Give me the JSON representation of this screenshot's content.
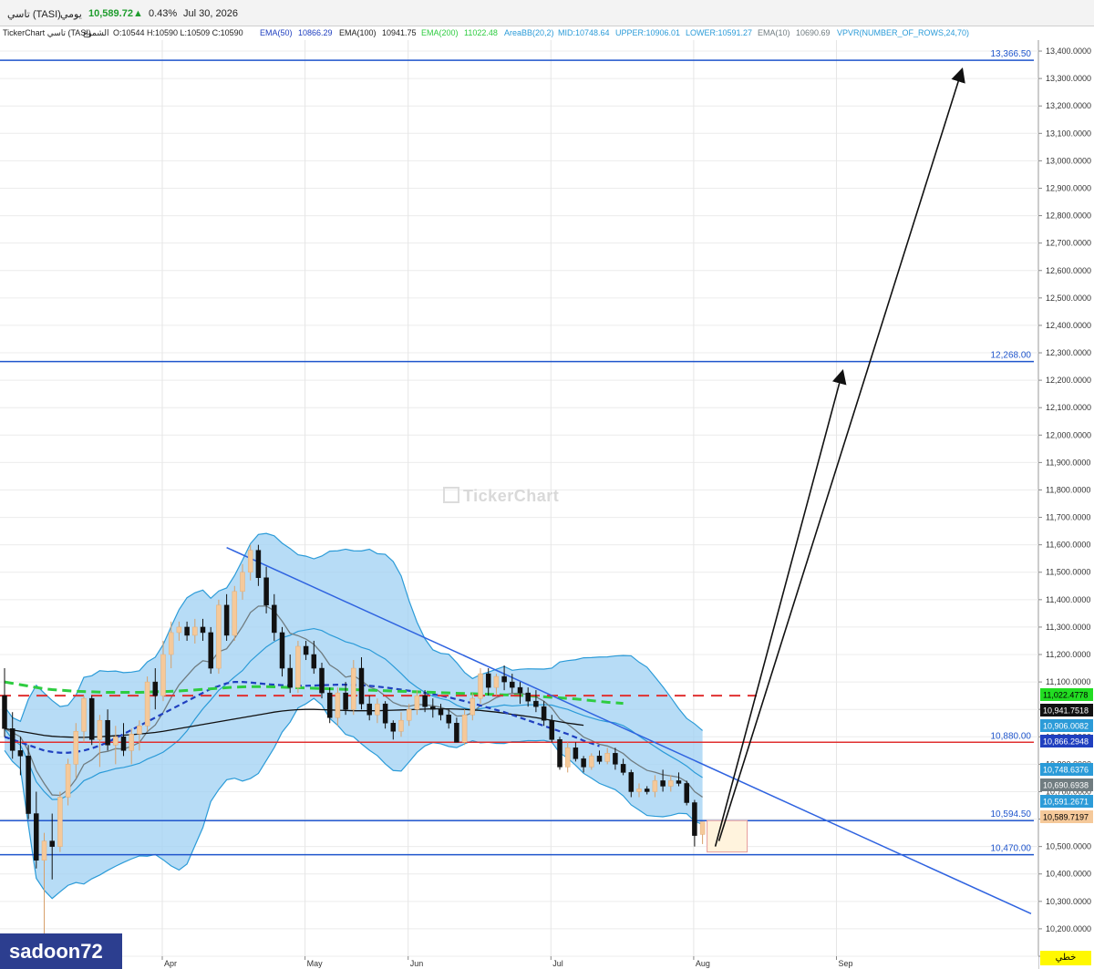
{
  "header": {
    "symbol": "تاسي (TASI)",
    "period": "يومي",
    "price": "10,589.72",
    "change_pct": "0.43%",
    "date": "Jul 30, 2026"
  },
  "legend": {
    "source": "TickerChart تاسي (TASI)",
    "candles_label": "الشموع",
    "ohlc": "O:10544  H:10590  L:10509  C:10590",
    "ema50_name": "EMA(50)",
    "ema50_value": "10866.29",
    "ema100_name": "EMA(100)",
    "ema100_value": "10941.75",
    "ema200_name": "EMA(200)",
    "ema200_value": "11022.48",
    "bb_name": "AreaBB(20,2)",
    "bb_mid": "MID:10748.64",
    "bb_upper": "UPPER:10906.01",
    "bb_lower": "LOWER:10591.27",
    "ema10_name": "EMA(10)",
    "ema10_value": "10690.69",
    "vpvr": "VPVR(NUMBER_OF_ROWS,24,70)"
  },
  "watermark": "TickerChart",
  "user_badge": "sadoon72",
  "scale_mode": "خطي",
  "colors": {
    "up_candle": "#f5c99a",
    "down_candle": "#111111",
    "bb_fill": "#9fd0f3",
    "bb_line": "#2b9bd8",
    "ema10": "#707c80",
    "ema50": "#1f3fbf",
    "ema100": "#111111",
    "ema200": "#2ecc40",
    "level_line": "#1f55cc",
    "resistance_red": "#e03030",
    "trendline": "#2f63e0",
    "arrow": "#111111"
  },
  "chart_data": {
    "type": "candlestick",
    "title": "تاسي (TASI)",
    "ylim": [
      10100,
      13440
    ],
    "y_ticks": [
      "13,400.0000",
      "13,300.0000",
      "13,200.0000",
      "13,100.0000",
      "13,000.0000",
      "12,900.0000",
      "12,800.0000",
      "12,700.0000",
      "12,600.0000",
      "12,500.0000",
      "12,400.0000",
      "12,300.0000",
      "12,200.0000",
      "12,100.0000",
      "12,000.0000",
      "11,900.0000",
      "11,800.0000",
      "11,700.0000",
      "11,600.0000",
      "11,500.0000",
      "11,400.0000",
      "11,300.0000",
      "11,200.0000",
      "11,100.0000",
      "11,000.0000",
      "10,900.0000",
      "10,800.0000",
      "10,700.0000",
      "10,600.0000",
      "10,500.0000",
      "10,400.0000",
      "10,300.0000",
      "10,200.0000",
      "10,100.0000"
    ],
    "x_tick_labels": [
      "Apr",
      "May",
      "Jun",
      "Jul",
      "Aug",
      "Sep"
    ],
    "grid": true,
    "levels": [
      {
        "label": "13,366.50",
        "value": 13366.5,
        "style": "solid"
      },
      {
        "label": "12,268.00",
        "value": 12268,
        "style": "solid"
      },
      {
        "label": "10,880.00",
        "value": 10880,
        "style": "solid-red"
      },
      {
        "label": "10,594.50",
        "value": 10594.5,
        "style": "solid"
      },
      {
        "label": "10,470.00",
        "value": 10470,
        "style": "solid"
      },
      {
        "value": 11050,
        "style": "dashed-red"
      }
    ],
    "price_badges": [
      {
        "label": "11,022.4778",
        "bg": "#22dd22",
        "fg": "#000000",
        "value": 11022.48
      },
      {
        "label": "10,941.7518",
        "bg": "#111111",
        "fg": "#ffffff",
        "value": 10941.75
      },
      {
        "label": "10,906.0082",
        "bg": "#2b9bd8",
        "fg": "#ffffff",
        "value": 10906.01
      },
      {
        "label": "10,866.2948",
        "bg": "#1f3fbf",
        "fg": "#ffffff",
        "value": 10866.29
      },
      {
        "label": "10,748.6376",
        "bg": "#2b9bd8",
        "fg": "#ffffff",
        "value": 10748.64
      },
      {
        "label": "10,690.6938",
        "bg": "#707c80",
        "fg": "#ffffff",
        "value": 10690.69
      },
      {
        "label": "10,591.2671",
        "bg": "#2b9bd8",
        "fg": "#ffffff",
        "value": 10591.27
      },
      {
        "label": "10,589.7197",
        "bg": "#f5c99a",
        "fg": "#000000",
        "value": 10589.72
      }
    ],
    "candles": [
      [
        11050,
        11150,
        10900,
        10930
      ],
      [
        10930,
        10990,
        10820,
        10850
      ],
      [
        10850,
        10900,
        10760,
        10830
      ],
      [
        10830,
        10870,
        10600,
        10620
      ],
      [
        10620,
        10700,
        10420,
        10450
      ],
      [
        10450,
        10550,
        10180,
        10520
      ],
      [
        10520,
        10620,
        10380,
        10500
      ],
      [
        10500,
        10700,
        10480,
        10680
      ],
      [
        10680,
        10820,
        10650,
        10800
      ],
      [
        10800,
        10950,
        10750,
        10920
      ],
      [
        10920,
        11050,
        10880,
        11040
      ],
      [
        11040,
        11050,
        10870,
        10890
      ],
      [
        10890,
        10980,
        10790,
        10960
      ],
      [
        10960,
        11000,
        10850,
        10870
      ],
      [
        10870,
        10940,
        10800,
        10900
      ],
      [
        10900,
        10950,
        10830,
        10850
      ],
      [
        10850,
        10930,
        10800,
        10910
      ],
      [
        10910,
        10960,
        10850,
        10940
      ],
      [
        10940,
        11120,
        10920,
        11100
      ],
      [
        11100,
        11150,
        11000,
        11050
      ],
      [
        11050,
        11250,
        11030,
        11200
      ],
      [
        11200,
        11320,
        11150,
        11280
      ],
      [
        11280,
        11320,
        11250,
        11300
      ],
      [
        11300,
        11320,
        11250,
        11270
      ],
      [
        11270,
        11330,
        11240,
        11300
      ],
      [
        11300,
        11330,
        11250,
        11280
      ],
      [
        11280,
        11300,
        11130,
        11150
      ],
      [
        11150,
        11400,
        11130,
        11380
      ],
      [
        11380,
        11420,
        11250,
        11270
      ],
      [
        11270,
        11450,
        11250,
        11430
      ],
      [
        11430,
        11530,
        11400,
        11500
      ],
      [
        11500,
        11600,
        11470,
        11580
      ],
      [
        11580,
        11600,
        11450,
        11480
      ],
      [
        11480,
        11520,
        11350,
        11380
      ],
      [
        11380,
        11420,
        11250,
        11280
      ],
      [
        11280,
        11300,
        11120,
        11150
      ],
      [
        11150,
        11200,
        11060,
        11080
      ],
      [
        11080,
        11250,
        11060,
        11230
      ],
      [
        11230,
        11250,
        11180,
        11200
      ],
      [
        11200,
        11250,
        11130,
        11150
      ],
      [
        11150,
        11170,
        11040,
        11060
      ],
      [
        11060,
        11080,
        10950,
        10970
      ],
      [
        10970,
        11080,
        10940,
        11060
      ],
      [
        11060,
        11100,
        10980,
        11000
      ],
      [
        11000,
        11180,
        10980,
        11150
      ],
      [
        11150,
        11190,
        11000,
        11020
      ],
      [
        11020,
        11050,
        10960,
        10980
      ],
      [
        10980,
        11040,
        10950,
        11020
      ],
      [
        11020,
        11030,
        10930,
        10950
      ],
      [
        10950,
        10960,
        10890,
        10920
      ],
      [
        10920,
        10990,
        10900,
        10960
      ],
      [
        10960,
        11020,
        10940,
        11000
      ],
      [
        11000,
        11070,
        10980,
        11050
      ],
      [
        11050,
        11070,
        10990,
        11010
      ],
      [
        11010,
        11040,
        10970,
        11000
      ],
      [
        11000,
        11020,
        10960,
        10980
      ],
      [
        10980,
        11000,
        10930,
        10950
      ],
      [
        10950,
        10970,
        10880,
        10880
      ],
      [
        10880,
        11000,
        10870,
        10980
      ],
      [
        10980,
        11060,
        10960,
        11040
      ],
      [
        11040,
        11150,
        11020,
        11130
      ],
      [
        11130,
        11150,
        11050,
        11080
      ],
      [
        11080,
        11130,
        11050,
        11120
      ],
      [
        11120,
        11160,
        11070,
        11100
      ],
      [
        11100,
        11130,
        11060,
        11080
      ],
      [
        11080,
        11100,
        11020,
        11060
      ],
      [
        11060,
        11080,
        11010,
        11030
      ],
      [
        11030,
        11070,
        10990,
        11010
      ],
      [
        11010,
        11030,
        10940,
        10960
      ],
      [
        10960,
        10980,
        10880,
        10890
      ],
      [
        10890,
        10900,
        10780,
        10790
      ],
      [
        10790,
        10880,
        10770,
        10860
      ],
      [
        10860,
        10880,
        10810,
        10820
      ],
      [
        10820,
        10830,
        10770,
        10790
      ],
      [
        10790,
        10840,
        10780,
        10830
      ],
      [
        10830,
        10850,
        10800,
        10810
      ],
      [
        10810,
        10860,
        10800,
        10840
      ],
      [
        10840,
        10860,
        10780,
        10800
      ],
      [
        10800,
        10820,
        10760,
        10770
      ],
      [
        10770,
        10780,
        10680,
        10700
      ],
      [
        10700,
        10730,
        10680,
        10710
      ],
      [
        10710,
        10720,
        10690,
        10700
      ],
      [
        10700,
        10760,
        10680,
        10740
      ],
      [
        10740,
        10780,
        10700,
        10720
      ],
      [
        10720,
        10760,
        10700,
        10740
      ],
      [
        10740,
        10770,
        10720,
        10730
      ],
      [
        10730,
        10740,
        10650,
        10660
      ],
      [
        10660,
        10670,
        10500,
        10540
      ],
      [
        10544,
        10590,
        10509,
        10590
      ]
    ],
    "ema200": [
      11100,
      11095,
      11090,
      11085,
      11080,
      11075,
      11072,
      11070,
      11068,
      11066,
      11065,
      11064,
      11063,
      11062,
      11062,
      11062,
      11062,
      11062,
      11063,
      11064,
      11065,
      11066,
      11067,
      11069,
      11071,
      11073,
      11075,
      11077,
      11079,
      11081,
      11082,
      11083,
      11083,
      11083,
      11082,
      11081,
      11080,
      11079,
      11078,
      11077,
      11076,
      11075,
      11074,
      11073,
      11072,
      11071,
      11070,
      11069,
      11068,
      11067,
      11066,
      11065,
      11064,
      11063,
      11062,
      11061,
      11060,
      11059,
      11058,
      11057,
      11056,
      11055,
      11054,
      11053,
      11052,
      11051,
      11050,
      11048,
      11046,
      11044,
      11042,
      11040,
      11038,
      11035,
      11032,
      11029,
      11026,
      11024,
      11022
    ],
    "ema100": [
      10930,
      10925,
      10920,
      10915,
      10910,
      10905,
      10902,
      10900,
      10899,
      10898,
      10898,
      10899,
      10900,
      10902,
      10904,
      10906,
      10908,
      10910,
      10913,
      10916,
      10920,
      10925,
      10930,
      10935,
      10940,
      10945,
      10950,
      10955,
      10960,
      10965,
      10970,
      10975,
      10980,
      10985,
      10990,
      10994,
      10997,
      10999,
      11000,
      11000,
      10999,
      10998,
      10997,
      10996,
      10995,
      10995,
      10995,
      10995,
      10996,
      10997,
      10998,
      10999,
      11000,
      11001,
      11002,
      11002,
      11002,
      11001,
      11000,
      10998,
      10996,
      10993,
      10990,
      10986,
      10982,
      10978,
      10974,
      10970,
      10965,
      10960,
      10955,
      10950,
      10946,
      10942
    ],
    "ema50": [
      10900,
      10890,
      10880,
      10870,
      10860,
      10850,
      10845,
      10842,
      10842,
      10845,
      10850,
      10858,
      10868,
      10880,
      10895,
      10910,
      10925,
      10940,
      10955,
      10970,
      10985,
      11000,
      11015,
      11030,
      11045,
      11060,
      11075,
      11085,
      11095,
      11100,
      11100,
      11098,
      11095,
      11092,
      11090,
      11088,
      11087,
      11086,
      11086,
      11087,
      11088,
      11089,
      11090,
      11090,
      11089,
      11088,
      11086,
      11083,
      11080,
      11076,
      11072,
      11068,
      11064,
      11060,
      11055,
      11050,
      11044,
      11037,
      11030,
      11022,
      11014,
      11006,
      10998,
      10990,
      10980,
      10970,
      10960,
      10950,
      10940,
      10930,
      10920,
      10910,
      10898,
      10886,
      10876,
      10866
    ]
  }
}
